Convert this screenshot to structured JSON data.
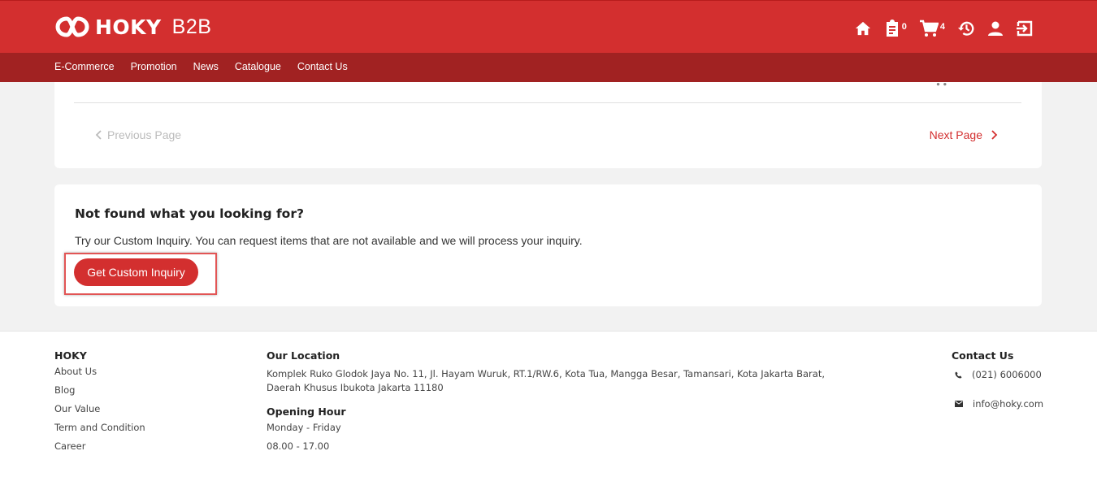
{
  "brand": {
    "name": "HOKY",
    "suffix": "B2B",
    "color": "#d32f2f"
  },
  "topbar": {
    "icons": [
      {
        "name": "home-icon"
      },
      {
        "name": "clipboard-icon",
        "count": "0"
      },
      {
        "name": "cart-icon",
        "count": "4"
      },
      {
        "name": "history-icon"
      },
      {
        "name": "user-icon"
      },
      {
        "name": "logout-icon"
      }
    ]
  },
  "nav": {
    "items": [
      "E-Commerce",
      "Promotion",
      "News",
      "Catalogue",
      "Contact Us"
    ]
  },
  "pager": {
    "prev": "Previous Page",
    "next": "Next Page"
  },
  "inquiry": {
    "title": "Not found what you looking for?",
    "description": "Try our Custom Inquiry. You can request items that are not available and we will process your inquiry.",
    "button": "Get Custom Inquiry"
  },
  "footer": {
    "hoky": {
      "title": "HOKY",
      "links": [
        "About Us",
        "Blog",
        "Our Value",
        "Term and Condition",
        "Career"
      ]
    },
    "location": {
      "title": "Our Location",
      "address_line1": "Komplek Ruko Glodok Jaya No. 11, Jl. Hayam Wuruk, RT.1/RW.6, Kota Tua, Mangga Besar, Tamansari, Kota Jakarta Barat,",
      "address_line2": "Daerah Khusus Ibukota Jakarta 11180",
      "hours_title": "Opening Hour",
      "days": "Monday - Friday",
      "hours": "08.00 - 17.00"
    },
    "contact": {
      "title": "Contact Us",
      "phone": "(021) 6006000",
      "email": "info@hoky.com"
    }
  }
}
